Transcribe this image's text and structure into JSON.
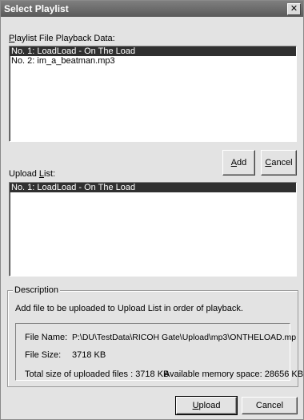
{
  "window": {
    "title": "Select Playlist",
    "close_glyph": "✕"
  },
  "playback_section": {
    "label_prefix": "",
    "label_mnemonic": "P",
    "label_rest": "laylist File Playback Data:",
    "items": [
      "No. 1:  LoadLoad - On The Load",
      "No. 2:  im_a_beatman.mp3"
    ],
    "selected_index": 0
  },
  "buttons": {
    "add_mnemonic": "A",
    "add_rest": "dd",
    "cancel_mnemonic": "C",
    "cancel_rest": "ancel",
    "upload_mnemonic": "U",
    "upload_rest": "pload",
    "cancel2": "Cancel"
  },
  "upload_section": {
    "label_prefix": "Upload ",
    "label_mnemonic": "L",
    "label_rest": "ist:",
    "items": [
      "No. 1:  LoadLoad - On The Load"
    ],
    "selected_index": 0
  },
  "description": {
    "legend": "Description",
    "text": "Add file to be uploaded to Upload List in order of playback.",
    "file_name_label": "File Name:",
    "file_name_value": "P:\\DU\\TestData\\RICOH Gate\\Upload\\mp3\\ONTHELOAD.mp",
    "file_size_label": "File Size:",
    "file_size_value": "3718 KB",
    "total_size": "Total size of uploaded files : 3718 KB",
    "available_memory": "Available memory space: 28656 KB"
  }
}
